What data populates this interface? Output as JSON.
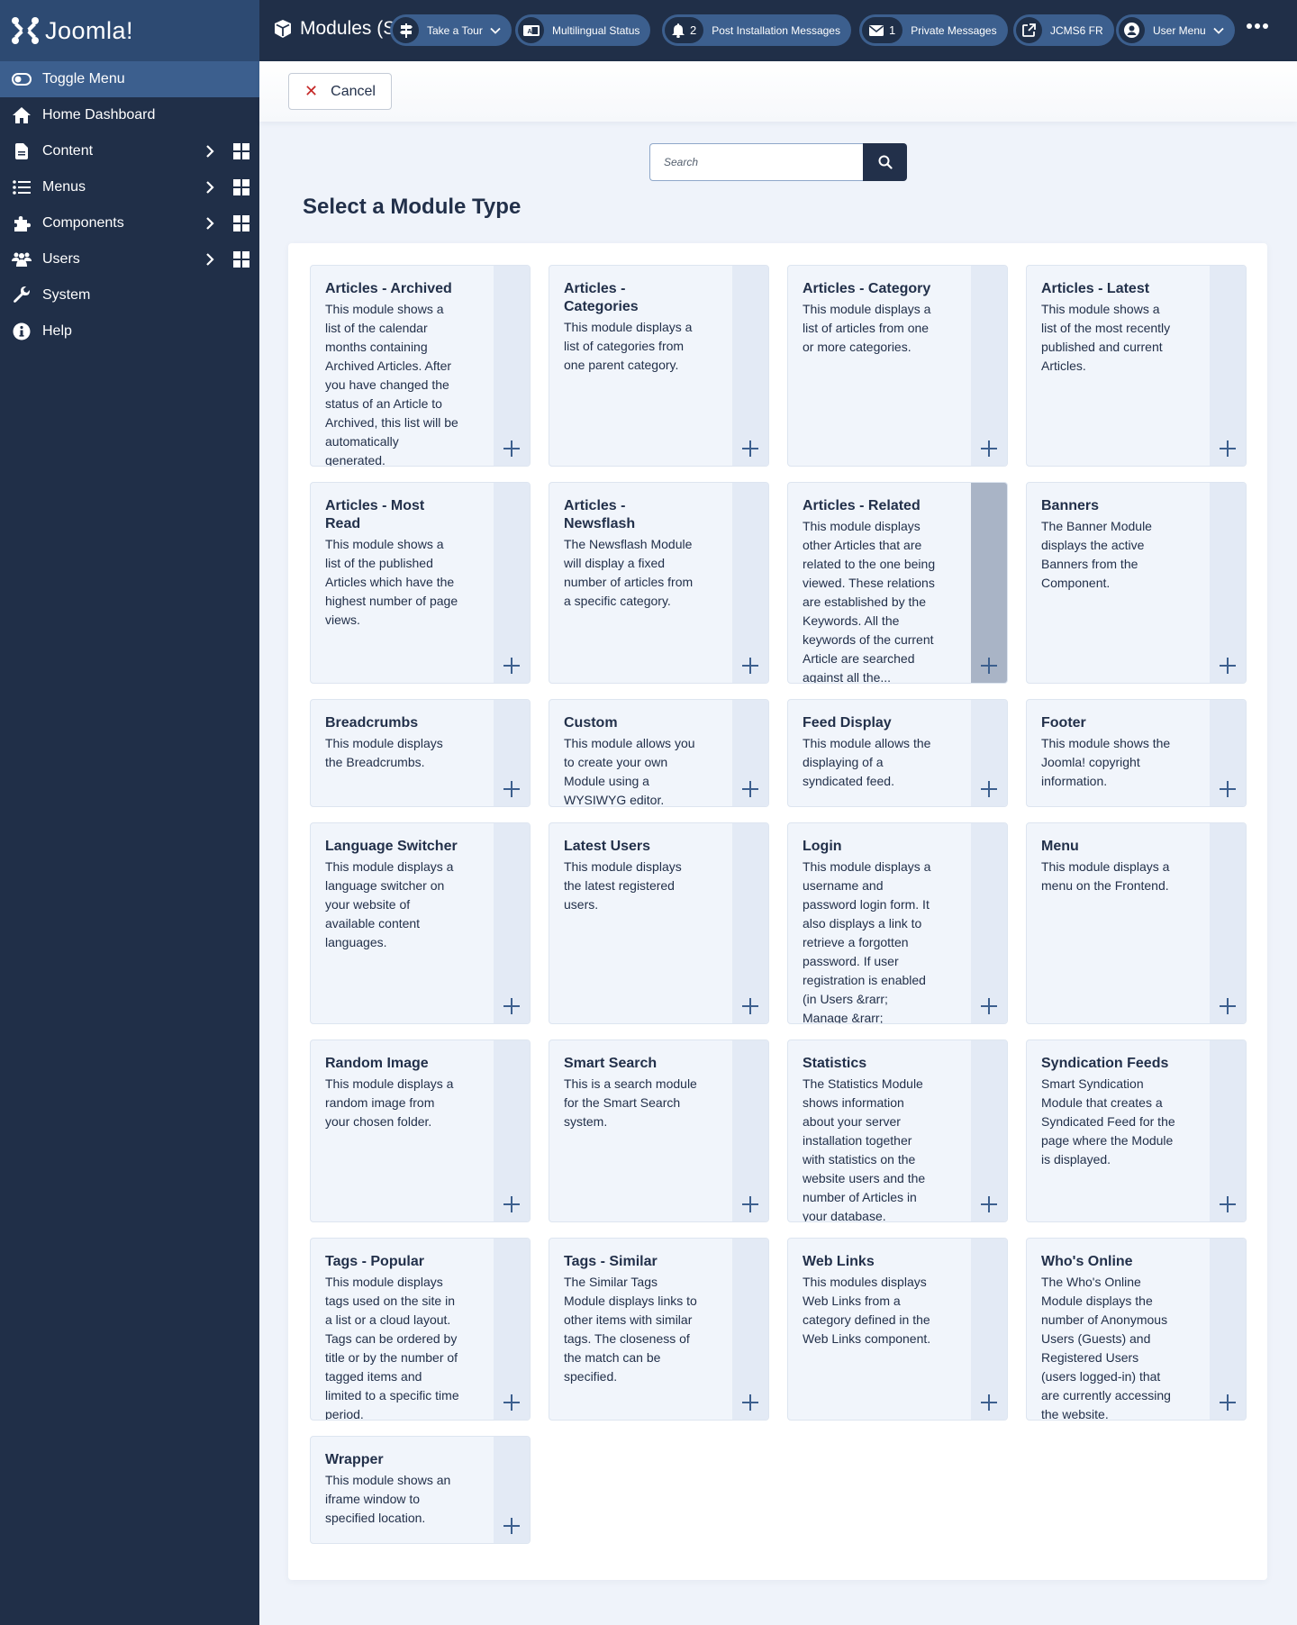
{
  "brand": {
    "name": "Joomla!"
  },
  "header": {
    "title": "Modules (Si",
    "title_icon": "cube-icon",
    "pills": [
      {
        "label": "Take a Tour",
        "icon": "signpost-icon",
        "has_caret": true
      },
      {
        "label": "Multilingual Status",
        "icon": "language-icon"
      },
      {
        "label": "Post Installation Messages",
        "icon": "bell-icon",
        "count": "2"
      },
      {
        "label": "Private Messages",
        "icon": "envelope-icon",
        "count": "1"
      },
      {
        "label": "JCMS6 FR",
        "icon": "external-link-icon"
      },
      {
        "label": "User Menu",
        "icon": "user-circle-icon",
        "has_caret": true
      }
    ],
    "more_icon": "ellipsis-icon"
  },
  "sidebar": {
    "items": [
      {
        "label": "Toggle Menu",
        "icon": "toggle-icon",
        "active": true
      },
      {
        "label": "Home Dashboard",
        "icon": "home-icon"
      },
      {
        "label": "Content",
        "icon": "file-icon",
        "has_submenu": true,
        "has_dashboard": true
      },
      {
        "label": "Menus",
        "icon": "list-icon",
        "has_submenu": true,
        "has_dashboard": true
      },
      {
        "label": "Components",
        "icon": "puzzle-icon",
        "has_submenu": true,
        "has_dashboard": true
      },
      {
        "label": "Users",
        "icon": "users-icon",
        "has_submenu": true,
        "has_dashboard": true
      },
      {
        "label": "System",
        "icon": "wrench-icon"
      },
      {
        "label": "Help",
        "icon": "info-icon"
      }
    ]
  },
  "toolbar": {
    "cancel_label": "Cancel"
  },
  "search": {
    "placeholder": "Search",
    "value": ""
  },
  "main": {
    "title": "Select a Module Type",
    "modules": [
      {
        "title": "Articles - Archived",
        "description": "This module shows a list of the calendar months containing Archived Articles. After you have changed the status of an Article to Archived, this list will be automatically generated."
      },
      {
        "title": "Articles - Categories",
        "description": "This module displays a list of categories from one parent category."
      },
      {
        "title": "Articles - Category",
        "description": "This module displays a list of articles from one or more categories."
      },
      {
        "title": "Articles - Latest",
        "description": "This module shows a list of the most recently published and current Articles."
      },
      {
        "title": "Articles - Most Read",
        "description": "This module shows a list of the published Articles which have the highest number of page views."
      },
      {
        "title": "Articles - Newsflash",
        "description": "The Newsflash Module will display a fixed number of articles from a specific category."
      },
      {
        "title": "Articles - Related",
        "description": "This module displays other Articles that are related to the one being viewed. These relations are established by the Keywords. All the keywords of the current Article are searched against all the...",
        "hovered": true
      },
      {
        "title": "Banners",
        "description": "The Banner Module displays the active Banners from the Component."
      },
      {
        "title": "Breadcrumbs",
        "description": "This module displays the Breadcrumbs."
      },
      {
        "title": "Custom",
        "description": "This module allows you to create your own Module using a WYSIWYG editor."
      },
      {
        "title": "Feed Display",
        "description": "This module allows the displaying of a syndicated feed."
      },
      {
        "title": "Footer",
        "description": "This module shows the Joomla! copyright information."
      },
      {
        "title": "Language Switcher",
        "description": "This module displays a language switcher on your website of available content languages."
      },
      {
        "title": "Latest Users",
        "description": "This module displays the latest registered users."
      },
      {
        "title": "Login",
        "description": "This module displays a username and password login form. It also displays a link to retrieve a forgotten password. If user registration is enabled (in Users &rarr; Manage &rarr; Options),..."
      },
      {
        "title": "Menu",
        "description": "This module displays a menu on the Frontend."
      },
      {
        "title": "Random Image",
        "description": "This module displays a random image from your chosen folder."
      },
      {
        "title": "Smart Search",
        "description": "This is a search module for the Smart Search system."
      },
      {
        "title": "Statistics",
        "description": "The Statistics Module shows information about your server installation together with statistics on the website users and the number of Articles in your database."
      },
      {
        "title": "Syndication Feeds",
        "description": "Smart Syndication Module that creates a Syndicated Feed for the page where the Module is displayed."
      },
      {
        "title": "Tags - Popular",
        "description": "This module displays tags used on the site in a list or a cloud layout. Tags can be ordered by title or by the number of tagged items and limited to a specific time period."
      },
      {
        "title": "Tags - Similar",
        "description": "The Similar Tags Module displays links to other items with similar tags. The closeness of the match can be specified."
      },
      {
        "title": "Web Links",
        "description": "This modules displays Web Links from a category defined in the Web Links component."
      },
      {
        "title": "Who's Online",
        "description": "The Who's Online Module displays the number of Anonymous Users (Guests) and Registered Users (users logged-in) that are currently accessing the website."
      },
      {
        "title": "Wrapper",
        "description": "This module shows an iframe window to specified location."
      }
    ]
  },
  "colors": {
    "sidebar_bg": "#202f48",
    "logo_bg": "#2d4a72",
    "active_item": "#3c5f8e",
    "cancel_icon": "#c52827",
    "card_bg": "#f1f5fb",
    "card_strip": "#e3eaf5",
    "card_strip_hover": "#a9b4c6"
  }
}
